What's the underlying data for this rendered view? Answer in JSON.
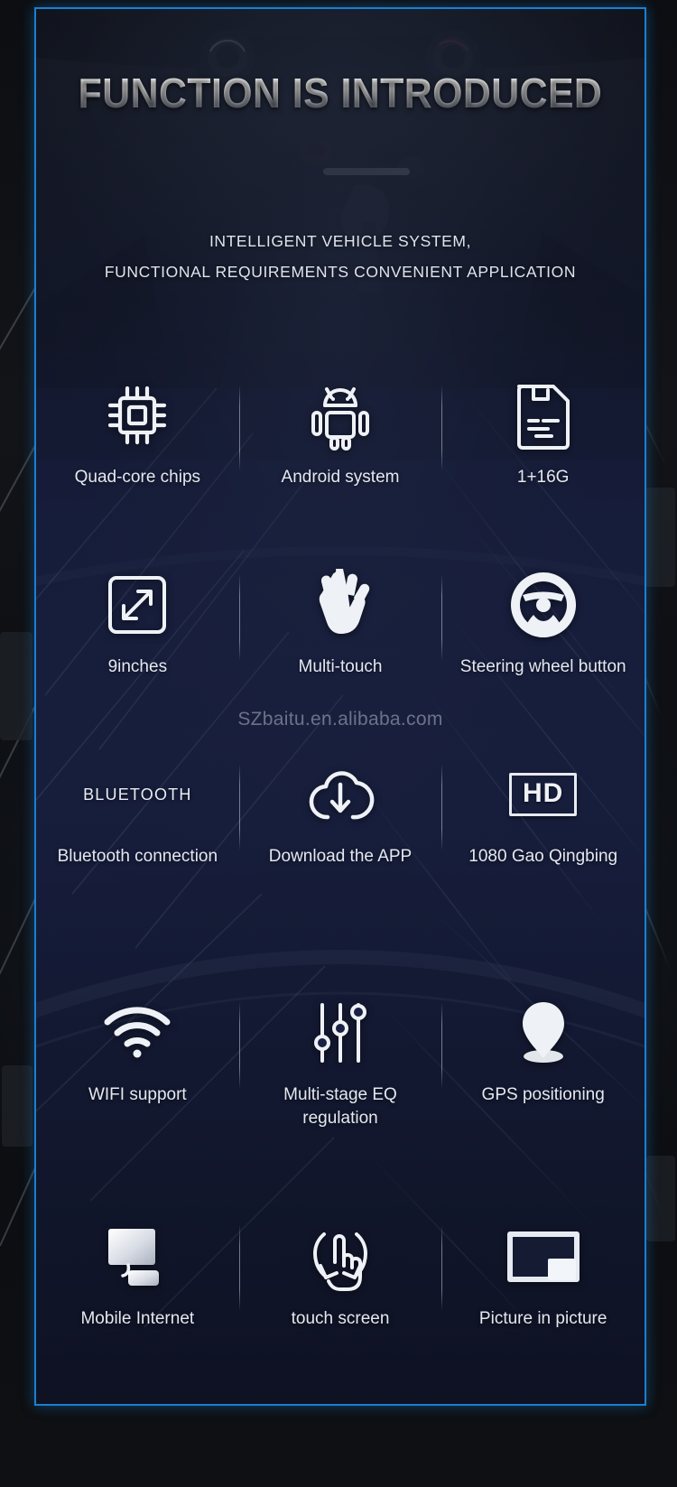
{
  "header": {
    "title": "FUNCTION IS INTRODUCED",
    "subtitle_line1": "INTELLIGENT VEHICLE SYSTEM,",
    "subtitle_line2": "FUNCTIONAL REQUIREMENTS CONVENIENT APPLICATION"
  },
  "watermark": "SZbaitu.en.alibaba.com",
  "colors": {
    "frame_border": "#1b7fd1",
    "panel_navy": "#161c36",
    "backdrop_dark": "#0c0e12",
    "text_light": "#e4e8f1",
    "icon_white": "#eef1f6"
  },
  "features": [
    {
      "icon": "cpu-chip-icon",
      "label": "Quad-core chips"
    },
    {
      "icon": "android-robot-icon",
      "label": "Android system"
    },
    {
      "icon": "memory-card-icon",
      "label": "1+16G"
    },
    {
      "icon": "expand-arrows-icon",
      "label": "9inches"
    },
    {
      "icon": "hand-icon",
      "label": "Multi-touch"
    },
    {
      "icon": "steering-wheel-icon",
      "label": "Steering wheel button"
    },
    {
      "icon": "bluetooth-wordmark",
      "icon_text": "BLUETOOTH",
      "label": "Bluetooth connection"
    },
    {
      "icon": "cloud-download-icon",
      "label": "Download the APP"
    },
    {
      "icon": "hd-badge-icon",
      "icon_text": "HD",
      "label": "1080 Gao Qingbing"
    },
    {
      "icon": "wifi-icon",
      "label": "WIFI support"
    },
    {
      "icon": "eq-sliders-icon",
      "label": "Multi-stage EQ\nregulation"
    },
    {
      "icon": "map-pin-icon",
      "label": "GPS positioning"
    },
    {
      "icon": "monitor-phone-icon",
      "label": "Mobile Internet"
    },
    {
      "icon": "touch-gesture-icon",
      "label": "touch screen"
    },
    {
      "icon": "picture-in-picture-icon",
      "label": "Picture in picture"
    }
  ]
}
